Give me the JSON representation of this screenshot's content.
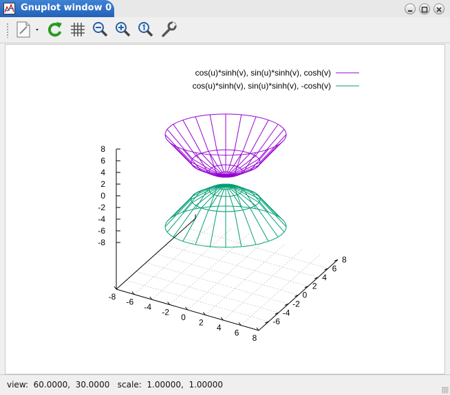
{
  "window": {
    "title": "Gnuplot window 0"
  },
  "toolbar": {
    "buttons": [
      "export-menu",
      "replot",
      "grid",
      "zoom-previous",
      "zoom-next",
      "autoscale",
      "settings"
    ]
  },
  "plot": {
    "legend": [
      {
        "label": "cos(u)*sinh(v), sin(u)*sinh(v), cosh(v)",
        "color": "#9400d3"
      },
      {
        "label": "cos(u)*sinh(v), sin(u)*sinh(v), -cosh(v)",
        "color": "#009e73"
      }
    ],
    "z_ticks": [
      "8",
      "6",
      "4",
      "2",
      "0",
      "-2",
      "-4",
      "-6",
      "-8"
    ],
    "x_ticks": [
      "-8",
      "-6",
      "-4",
      "-2",
      "0",
      "2",
      "4",
      "6",
      "8"
    ],
    "y_ticks": [
      "-6",
      "-4",
      "-2",
      "0",
      "2",
      "4",
      "6",
      "8"
    ]
  },
  "chart_data": {
    "type": "surface",
    "title": "",
    "series": [
      {
        "name": "cos(u)*sinh(v), sin(u)*sinh(v), cosh(v)"
      },
      {
        "name": "cos(u)*sinh(v), sin(u)*sinh(v), -cosh(v)"
      }
    ],
    "xlim": [
      -8,
      8
    ],
    "ylim": [
      -8,
      8
    ],
    "zlim": [
      -8,
      8
    ],
    "grid": true,
    "legend_position": "top-right"
  },
  "status": {
    "text": "view:  60.0000,  30.0000   scale:  1.00000,  1.00000"
  }
}
